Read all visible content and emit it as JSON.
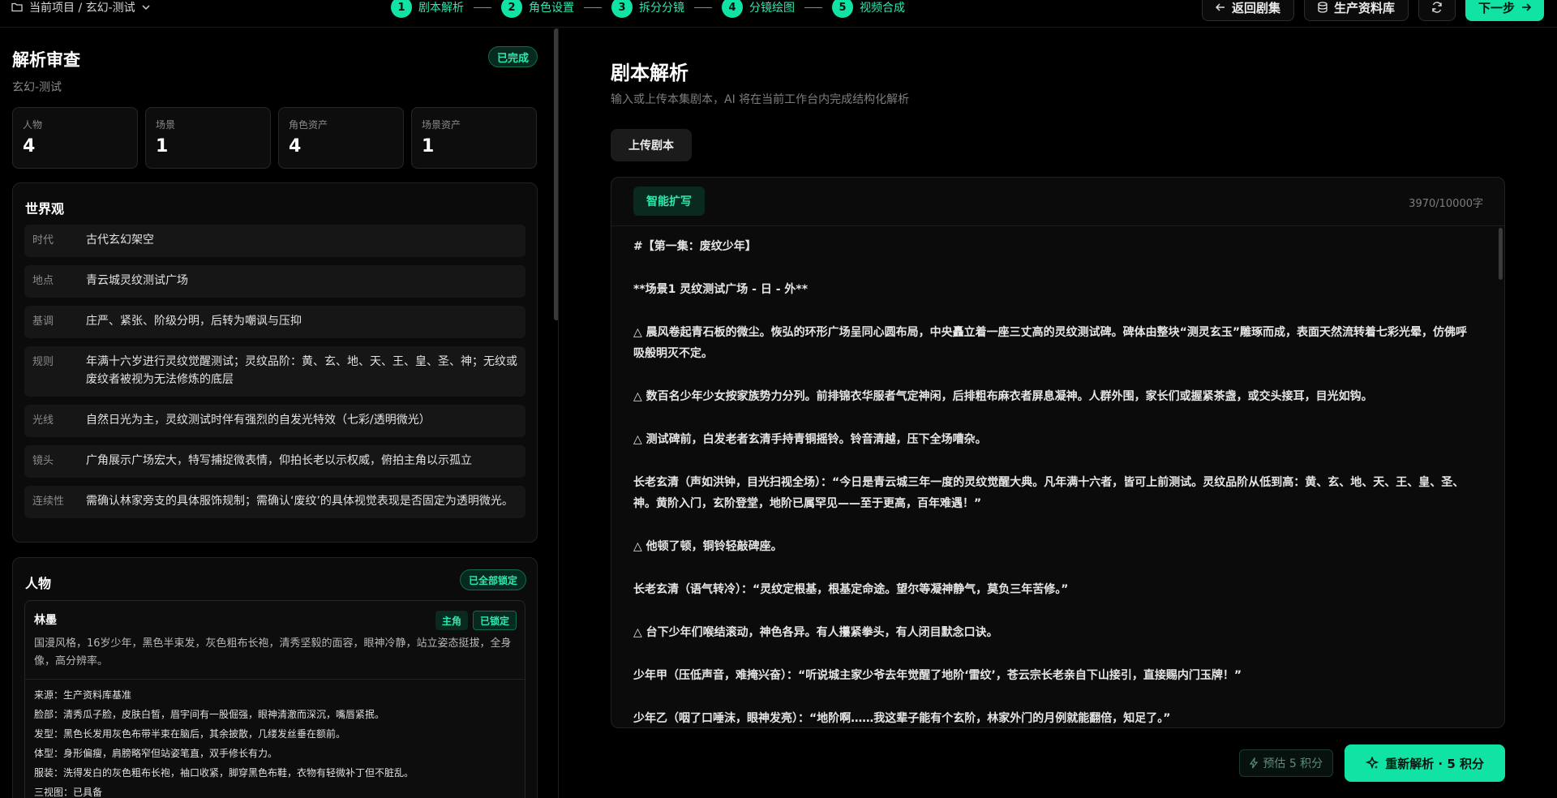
{
  "topbar": {
    "project": "当前项目 / 玄幻-测试",
    "steps": [
      {
        "num": "1",
        "label": "剧本解析"
      },
      {
        "num": "2",
        "label": "角色设置"
      },
      {
        "num": "3",
        "label": "拆分分镜"
      },
      {
        "num": "4",
        "label": "分镜绘图"
      },
      {
        "num": "5",
        "label": "视频合成"
      }
    ],
    "back_label": "返回剧集",
    "library_label": "生产资料库",
    "next_label": "下一步"
  },
  "left": {
    "title": "解析审查",
    "subtitle": "玄幻-测试",
    "status": "已完成",
    "stats": [
      {
        "label": "人物",
        "value": "4"
      },
      {
        "label": "场景",
        "value": "1"
      },
      {
        "label": "角色资产",
        "value": "4"
      },
      {
        "label": "场景资产",
        "value": "1"
      }
    ],
    "world": {
      "title": "世界观",
      "rows": [
        {
          "key": "时代",
          "value": "古代玄幻架空"
        },
        {
          "key": "地点",
          "value": "青云城灵纹测试广场"
        },
        {
          "key": "基调",
          "value": "庄严、紧张、阶级分明，后转为嘲讽与压抑"
        },
        {
          "key": "规则",
          "value": "年满十六岁进行灵纹觉醒测试；灵纹品阶：黄、玄、地、天、王、皇、圣、神；无纹或废纹者被视为无法修炼的底层"
        },
        {
          "key": "光线",
          "value": "自然日光为主，灵纹测试时伴有强烈的自发光特效（七彩/透明微光）"
        },
        {
          "key": "镜头",
          "value": "广角展示广场宏大，特写捕捉微表情，仰拍长老以示权威，俯拍主角以示孤立"
        },
        {
          "key": "连续性",
          "value": "需确认林家旁支的具体服饰规制；需确认‘废纹’的具体视觉表现是否固定为透明微光。"
        }
      ]
    },
    "people": {
      "title": "人物",
      "badge": "已全部锁定",
      "person": {
        "name": "林墨",
        "tag_role": "主角",
        "tag_lock": "已锁定",
        "desc": "国漫风格，16岁少年，黑色半束发，灰色粗布长袍，清秀坚毅的面容，眼神冷静，站立姿态挺拔，全身像，高分辨率。",
        "details": [
          "来源：生产资料库基准",
          "脸部：清秀瓜子脸，皮肤白皙，眉宇间有一股倔强，眼神清澈而深沉，嘴唇紧抿。",
          "发型：黑色长发用灰色布带半束在脑后，其余披散，几缕发丝垂在额前。",
          "体型：身形偏瘦，肩膀略窄但站姿笔直，双手修长有力。",
          "服装：洗得发白的灰色粗布长袍，袖口收紧，脚穿黑色布鞋，衣物有轻微补丁但不脏乱。",
          "三视图：已具备"
        ]
      }
    }
  },
  "right": {
    "title": "剧本解析",
    "subtitle": "输入或上传本集剧本，AI 将在当前工作台内完成结构化解析",
    "upload_label": "上传剧本",
    "expand_label": "智能扩写",
    "char_count": "3970/10000字",
    "script_lines": [
      "#【第一集：废纹少年】",
      "**场景1 灵纹测试广场 - 日 - 外**",
      "△ 晨风卷起青石板的微尘。恢弘的环形广场呈同心圆布局，中央矗立着一座三丈高的灵纹测试碑。碑体由整块“测灵玄玉”雕琢而成，表面天然流转着七彩光晕，仿佛呼吸般明灭不定。",
      "△ 数百名少年少女按家族势力分列。前排锦衣华服者气定神闲，后排粗布麻衣者屏息凝神。人群外围，家长们或握紧茶盏，或交头接耳，目光如钩。",
      "△ 测试碑前，白发老者玄清手持青铜摇铃。铃音清越，压下全场嘈杂。",
      "长老玄清（声如洪钟，目光扫视全场）：“今日是青云城三年一度的灵纹觉醒大典。凡年满十六者，皆可上前测试。灵纹品阶从低到高：黄、玄、地、天、王、皇、圣、神。黄阶入门，玄阶登堂，地阶已属罕见——至于更高，百年难遇！”",
      "△ 他顿了顿，铜铃轻敲碑座。",
      "长老玄清（语气转冷）：“灵纹定根基，根基定命途。望尔等凝神静气，莫负三年苦修。”",
      "△ 台下少年们喉结滚动，神色各异。有人攥紧拳头，有人闭目默念口诀。",
      "少年甲（压低声音，难掩兴奋）：“听说城主家少爷去年觉醒了地阶‘雷纹’，苍云宗长老亲自下山接引，直接赐内门玉牌！”",
      "少年乙（咽了口唾沫，眼神发亮）：“地阶啊……我这辈子能有个玄阶，林家外门的月例就能翻倍，知足了。”"
    ],
    "estimate_label": "预估 5 积分",
    "reparse_label": "重新解析 · 5 积分"
  },
  "colors": {
    "accent": "#10e3a4",
    "background": "#000000",
    "panel": "#0b0b0b"
  }
}
